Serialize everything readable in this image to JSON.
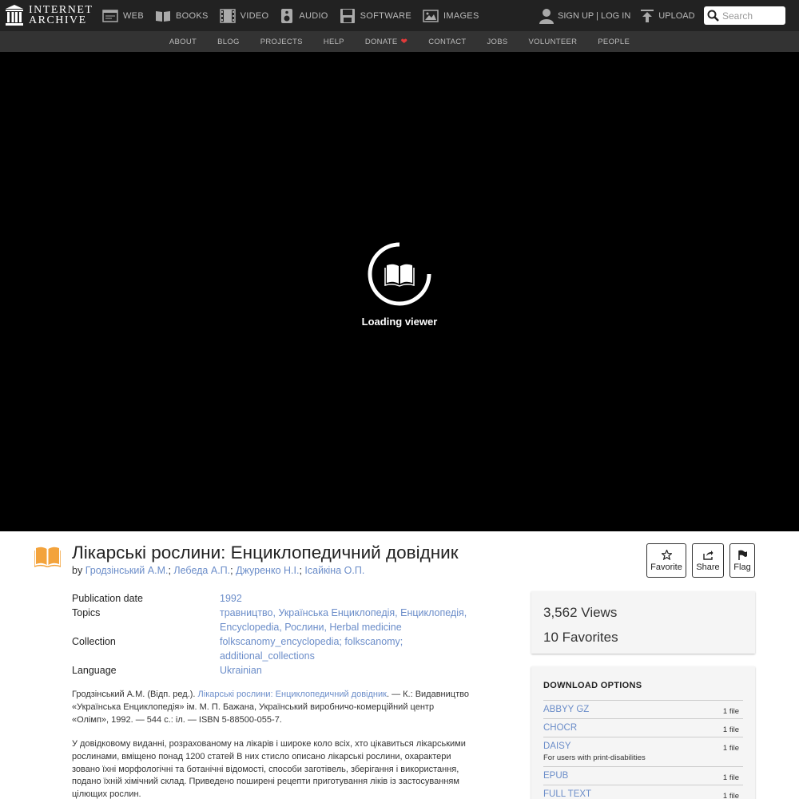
{
  "logo": {
    "line1": "INTERNET",
    "line2": "ARCHIVE"
  },
  "media_nav": [
    {
      "label": "WEB",
      "icon": "web-icon"
    },
    {
      "label": "BOOKS",
      "icon": "books-icon"
    },
    {
      "label": "VIDEO",
      "icon": "video-icon"
    },
    {
      "label": "AUDIO",
      "icon": "audio-icon"
    },
    {
      "label": "SOFTWARE",
      "icon": "software-icon"
    },
    {
      "label": "IMAGES",
      "icon": "images-icon"
    }
  ],
  "user": {
    "signup": "SIGN UP | LOG IN",
    "upload": "UPLOAD"
  },
  "search": {
    "placeholder": "Search"
  },
  "subnav": [
    "ABOUT",
    "BLOG",
    "PROJECTS",
    "HELP",
    "DONATE",
    "CONTACT",
    "JOBS",
    "VOLUNTEER",
    "PEOPLE"
  ],
  "viewer": {
    "status": "Loading viewer"
  },
  "item": {
    "title": "Лікарські рослини: Енциклопедичний довідник",
    "by": "by",
    "authors": [
      "Гродзінський А.М.",
      "Лебеда А.П.",
      "Джуренко Н.І.",
      "Ісайкіна О.П."
    ]
  },
  "actions": {
    "favorite": "Favorite",
    "share": "Share",
    "flag": "Flag"
  },
  "metadata": {
    "pubdate_key": "Publication date",
    "pubdate_val": "1992",
    "topics_key": "Topics",
    "topics_line1": "травництво, Українська Енциклопедія, Енциклопедія,",
    "topics_line2": "Encyclopedia, Рослини, Herbal medicine",
    "collection_key": "Collection",
    "collection_line1": "folkscanomy_encyclopedia; folkscanomy;",
    "collection_line2": "additional_collections",
    "language_key": "Language",
    "language_val": "Ukrainian"
  },
  "description": {
    "p1_a": "Гродзінський А.М. (Відп. ред.). ",
    "p1_link": "Лікарські рослини: Енциклопедичний довідник",
    "p1_b": ". — К.: Видавництво",
    "p1_line2": "«Українська Енциклопедія» ім. М. П. Бажана, Український виробничо-комерційний центр",
    "p1_line3": "«Олімп», 1992. — 544 с.: іл. — ISBN 5-88500-055-7.",
    "p2_line1": "У довідковому виданні, розрахованому на лікарів і широке коло всіх, хто цікавиться лікарськими",
    "p2_line2": "рослинами, вміщено понад 1200 статей В них стисло описано лікарські рослини, охарактери",
    "p2_line3": "зовано їхні морфологічні та ботанічні відомості, способи заготівель, зберігання і використання,",
    "p2_line4": "подано їхній хімічний склад. Приведено поширені рецепти приготування ліків із застосуванням",
    "p2_line5": "цілющих рослин."
  },
  "stats": {
    "views_num": "3,562",
    "views_label": "Views",
    "favs_num": "10",
    "favs_label": "Favorites"
  },
  "downloads": {
    "title": "DOWNLOAD OPTIONS",
    "items": [
      {
        "name": "ABBYY GZ",
        "count": "1 file",
        "sub": ""
      },
      {
        "name": "CHOCR",
        "count": "1 file",
        "sub": ""
      },
      {
        "name": "DAISY",
        "count": "1 file",
        "sub": "For users with print-disabilities"
      },
      {
        "name": "EPUB",
        "count": "1 file",
        "sub": ""
      },
      {
        "name": "FULL TEXT",
        "count": "1 file",
        "sub": ""
      }
    ]
  },
  "colors": {
    "topbar": "#222222",
    "subnav": "#333333",
    "viewer": "#000000",
    "link": "#6b8dc9",
    "book_icon": "#f3a33c",
    "heart": "#e23a3a"
  }
}
